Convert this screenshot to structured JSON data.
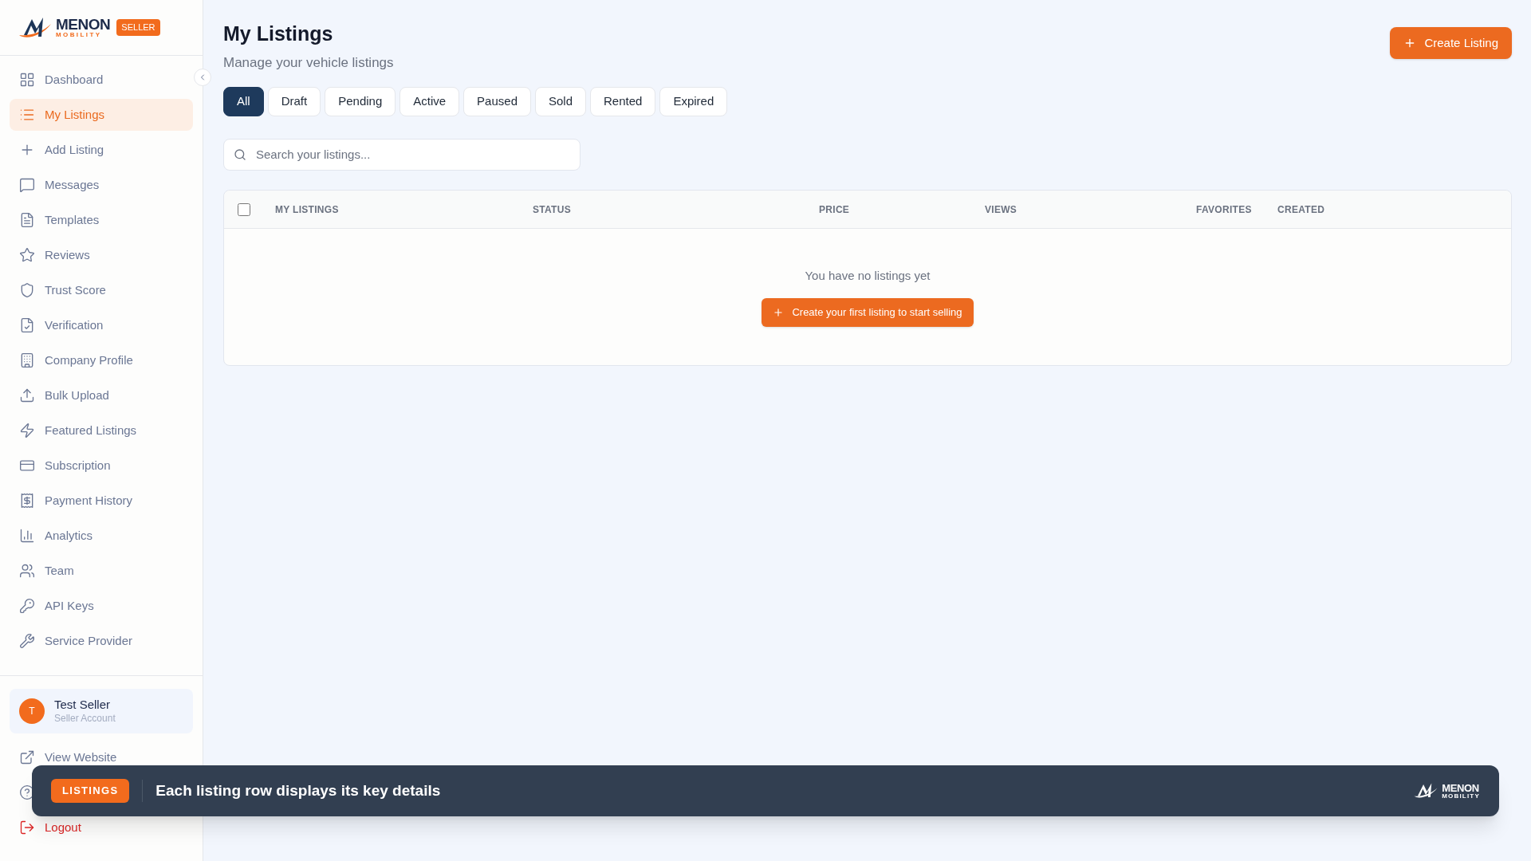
{
  "sidebar": {
    "logo": {
      "name": "MENON",
      "tagline": "MOBILITY"
    },
    "badge": "SELLER",
    "items": [
      {
        "label": "Dashboard",
        "selected": false
      },
      {
        "label": "My Listings",
        "selected": true
      },
      {
        "label": "Add Listing",
        "selected": false
      },
      {
        "label": "Messages",
        "selected": false
      },
      {
        "label": "Templates",
        "selected": false
      },
      {
        "label": "Reviews",
        "selected": false
      },
      {
        "label": "Trust Score",
        "selected": false
      },
      {
        "label": "Verification",
        "selected": false
      },
      {
        "label": "Company Profile",
        "selected": false
      },
      {
        "label": "Bulk Upload",
        "selected": false
      },
      {
        "label": "Featured Listings",
        "selected": false
      },
      {
        "label": "Subscription",
        "selected": false
      },
      {
        "label": "Payment History",
        "selected": false
      },
      {
        "label": "Analytics",
        "selected": false
      },
      {
        "label": "Team",
        "selected": false
      },
      {
        "label": "API Keys",
        "selected": false
      },
      {
        "label": "Service Provider",
        "selected": false
      }
    ],
    "user": {
      "initial": "T",
      "name": "Test Seller",
      "role": "Seller Account"
    },
    "footer_items": [
      {
        "label": "View Website",
        "kind": "link"
      },
      {
        "label": "Logout",
        "kind": "danger"
      }
    ]
  },
  "header": {
    "title": "My Listings",
    "subtitle": "Manage your vehicle listings",
    "action": "Create Listing"
  },
  "filters": [
    {
      "label": "All",
      "selected": true
    },
    {
      "label": "Draft",
      "selected": false
    },
    {
      "label": "Pending",
      "selected": false
    },
    {
      "label": "Active",
      "selected": false
    },
    {
      "label": "Paused",
      "selected": false
    },
    {
      "label": "Sold",
      "selected": false
    },
    {
      "label": "Rented",
      "selected": false
    },
    {
      "label": "Expired",
      "selected": false
    }
  ],
  "search": {
    "placeholder": "Search your listings..."
  },
  "table": {
    "select_all_checked": false,
    "columns": [
      "MY LISTINGS",
      "STATUS",
      "PRICE",
      "VIEWS",
      "FAVORITES",
      "CREATED"
    ],
    "empty_message": "You have no listings yet",
    "empty_action": "Create your first listing to start selling"
  },
  "banner": {
    "tag": "LISTINGS",
    "text": "Each listing row displays its key details",
    "logo": {
      "name": "MENON",
      "tagline": "MOBILITY"
    }
  }
}
